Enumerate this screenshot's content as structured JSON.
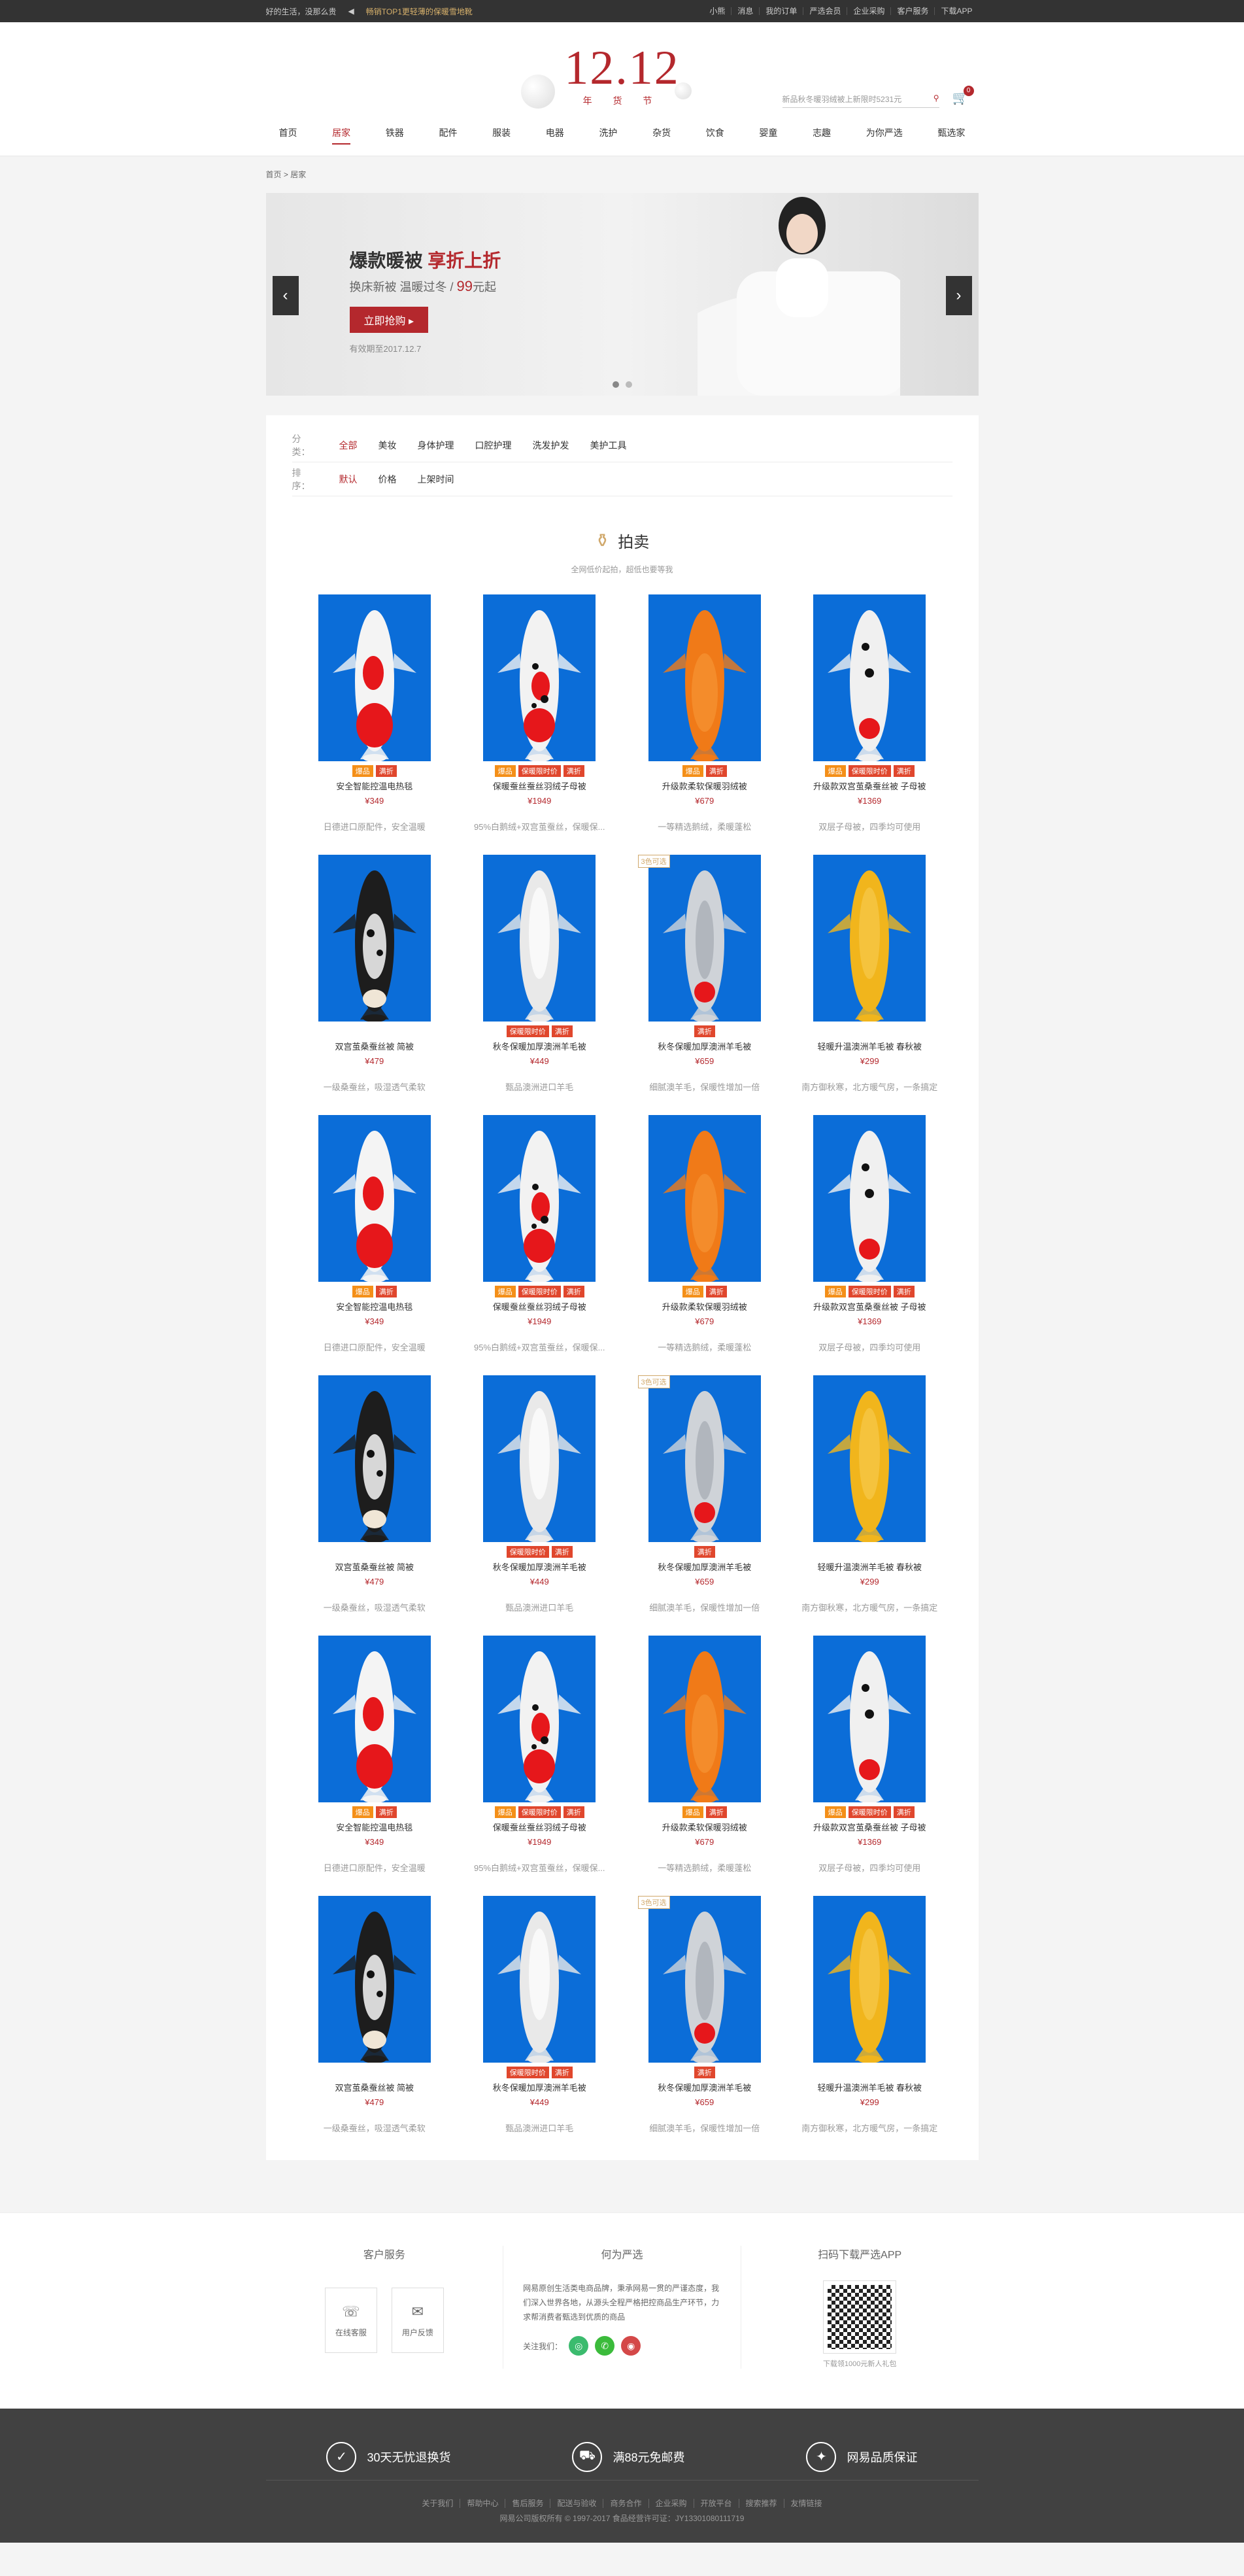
{
  "topbar": {
    "left_links": [
      "好的生活，没那么贵"
    ],
    "promo": "畅销TOP1更轻薄的保暖雪地靴",
    "right_links": [
      "小熊",
      "消息",
      "我的订单",
      "严选会员",
      "企业采购",
      "客户服务",
      "下载APP"
    ]
  },
  "header": {
    "logo_big": "12.12",
    "logo_sub": "年 货 节",
    "search_placeholder": "新品秋冬暖羽绒被上新限时5231元",
    "cart_count": "0",
    "nav": [
      "首页",
      "居家",
      "铁器",
      "配件",
      "服装",
      "电器",
      "洗护",
      "杂货",
      "饮食",
      "婴童",
      "志趣",
      "为你严选",
      "甄选家"
    ],
    "nav_active_index": 1
  },
  "breadcrumb": [
    "首页",
    "居家"
  ],
  "banner": {
    "title_a": "爆款暖被",
    "title_b": "享折上折",
    "sub_a": "换床新被 温暖过冬 / ",
    "price": "99",
    "sub_b": "元起",
    "button": "立即抢购",
    "date": "有效期至2017.12.7",
    "prev": "‹",
    "next": "›"
  },
  "filters": {
    "category_label": "分类：",
    "categories": [
      "全部",
      "美妆",
      "身体护理",
      "口腔护理",
      "洗发护发",
      "美护工具"
    ],
    "category_active": 0,
    "sort_label": "排序：",
    "sorts": [
      "默认",
      "价格",
      "上架时间"
    ],
    "sort_active": 0
  },
  "section": {
    "title": "拍卖",
    "desc": "全网低价起拍，超低也要等我"
  },
  "products": [
    {
      "name": "安全智能控温电热毯",
      "price": "¥349",
      "desc": "日德进口原配件，安全温暖",
      "tags": [
        [
          "爆品",
          "o"
        ],
        [
          "满折",
          "r"
        ]
      ],
      "corner": "",
      "fish": "kohaku"
    },
    {
      "name": "保暖蚕丝蚕丝羽绒子母被",
      "price": "¥1949",
      "desc": "95%白鹅绒+双宫茧蚕丝，保暖保...",
      "tags": [
        [
          "爆品",
          "o"
        ],
        [
          "保暖限时价",
          "r"
        ],
        [
          "满折",
          "r"
        ]
      ],
      "corner": "",
      "fish": "sanke"
    },
    {
      "name": "升级款柔软保暖羽绒被",
      "price": "¥679",
      "desc": "一等精选鹅绒，柔暖蓬松",
      "tags": [
        [
          "爆品",
          "o"
        ],
        [
          "满折",
          "r"
        ]
      ],
      "corner": "",
      "fish": "orange"
    },
    {
      "name": "升级款双宫茧桑蚕丝被 子母被",
      "price": "¥1369",
      "desc": "双层子母被，四季均可使用",
      "tags": [
        [
          "爆品",
          "o"
        ],
        [
          "保暖限时价",
          "r"
        ],
        [
          "满折",
          "r"
        ]
      ],
      "corner": "",
      "fish": "tancho"
    },
    {
      "name": "双宫茧桑蚕丝被 简被",
      "price": "¥479",
      "desc": "一级桑蚕丝，吸湿透气柔软",
      "tags": [],
      "corner": "",
      "fish": "showa"
    },
    {
      "name": "秋冬保暖加厚澳洲羊毛被",
      "price": "¥449",
      "desc": "甄品澳洲进口羊毛",
      "tags": [
        [
          "保暖限时价",
          "r"
        ],
        [
          "满折",
          "r"
        ]
      ],
      "corner": "",
      "fish": "white"
    },
    {
      "name": "秋冬保暖加厚澳洲羊毛被",
      "price": "¥659",
      "desc": "细腻澳羊毛，保暖性增加一倍",
      "tags": [
        [
          "满折",
          "r"
        ]
      ],
      "corner": "3色可选",
      "fish": "ginrin"
    },
    {
      "name": "轻暖升温澳洲羊毛被 春秋被",
      "price": "¥299",
      "desc": "南方御秋寒，北方暖气房，一条搞定",
      "tags": [],
      "corner": "",
      "fish": "yellow"
    },
    {
      "name": "安全智能控温电热毯",
      "price": "¥349",
      "desc": "日德进口原配件，安全温暖",
      "tags": [
        [
          "爆品",
          "o"
        ],
        [
          "满折",
          "r"
        ]
      ],
      "corner": "",
      "fish": "kohaku"
    },
    {
      "name": "保暖蚕丝蚕丝羽绒子母被",
      "price": "¥1949",
      "desc": "95%白鹅绒+双宫茧蚕丝，保暖保...",
      "tags": [
        [
          "爆品",
          "o"
        ],
        [
          "保暖限时价",
          "r"
        ],
        [
          "满折",
          "r"
        ]
      ],
      "corner": "",
      "fish": "sanke"
    },
    {
      "name": "升级款柔软保暖羽绒被",
      "price": "¥679",
      "desc": "一等精选鹅绒，柔暖蓬松",
      "tags": [
        [
          "爆品",
          "o"
        ],
        [
          "满折",
          "r"
        ]
      ],
      "corner": "",
      "fish": "orange"
    },
    {
      "name": "升级款双宫茧桑蚕丝被 子母被",
      "price": "¥1369",
      "desc": "双层子母被，四季均可使用",
      "tags": [
        [
          "爆品",
          "o"
        ],
        [
          "保暖限时价",
          "r"
        ],
        [
          "满折",
          "r"
        ]
      ],
      "corner": "",
      "fish": "tancho"
    },
    {
      "name": "双宫茧桑蚕丝被 简被",
      "price": "¥479",
      "desc": "一级桑蚕丝，吸湿透气柔软",
      "tags": [],
      "corner": "",
      "fish": "showa"
    },
    {
      "name": "秋冬保暖加厚澳洲羊毛被",
      "price": "¥449",
      "desc": "甄品澳洲进口羊毛",
      "tags": [
        [
          "保暖限时价",
          "r"
        ],
        [
          "满折",
          "r"
        ]
      ],
      "corner": "",
      "fish": "white"
    },
    {
      "name": "秋冬保暖加厚澳洲羊毛被",
      "price": "¥659",
      "desc": "细腻澳羊毛，保暖性增加一倍",
      "tags": [
        [
          "满折",
          "r"
        ]
      ],
      "corner": "3色可选",
      "fish": "ginrin"
    },
    {
      "name": "轻暖升温澳洲羊毛被 春秋被",
      "price": "¥299",
      "desc": "南方御秋寒，北方暖气房，一条搞定",
      "tags": [],
      "corner": "",
      "fish": "yellow"
    },
    {
      "name": "安全智能控温电热毯",
      "price": "¥349",
      "desc": "日德进口原配件，安全温暖",
      "tags": [
        [
          "爆品",
          "o"
        ],
        [
          "满折",
          "r"
        ]
      ],
      "corner": "",
      "fish": "kohaku"
    },
    {
      "name": "保暖蚕丝蚕丝羽绒子母被",
      "price": "¥1949",
      "desc": "95%白鹅绒+双宫茧蚕丝，保暖保...",
      "tags": [
        [
          "爆品",
          "o"
        ],
        [
          "保暖限时价",
          "r"
        ],
        [
          "满折",
          "r"
        ]
      ],
      "corner": "",
      "fish": "sanke"
    },
    {
      "name": "升级款柔软保暖羽绒被",
      "price": "¥679",
      "desc": "一等精选鹅绒，柔暖蓬松",
      "tags": [
        [
          "爆品",
          "o"
        ],
        [
          "满折",
          "r"
        ]
      ],
      "corner": "",
      "fish": "orange"
    },
    {
      "name": "升级款双宫茧桑蚕丝被 子母被",
      "price": "¥1369",
      "desc": "双层子母被，四季均可使用",
      "tags": [
        [
          "爆品",
          "o"
        ],
        [
          "保暖限时价",
          "r"
        ],
        [
          "满折",
          "r"
        ]
      ],
      "corner": "",
      "fish": "tancho"
    },
    {
      "name": "双宫茧桑蚕丝被 简被",
      "price": "¥479",
      "desc": "一级桑蚕丝，吸湿透气柔软",
      "tags": [],
      "corner": "",
      "fish": "showa"
    },
    {
      "name": "秋冬保暖加厚澳洲羊毛被",
      "price": "¥449",
      "desc": "甄品澳洲进口羊毛",
      "tags": [
        [
          "保暖限时价",
          "r"
        ],
        [
          "满折",
          "r"
        ]
      ],
      "corner": "",
      "fish": "white"
    },
    {
      "name": "秋冬保暖加厚澳洲羊毛被",
      "price": "¥659",
      "desc": "细腻澳羊毛，保暖性增加一倍",
      "tags": [
        [
          "满折",
          "r"
        ]
      ],
      "corner": "3色可选",
      "fish": "ginrin"
    },
    {
      "name": "轻暖升温澳洲羊毛被 春秋被",
      "price": "¥299",
      "desc": "南方御秋寒，北方暖气房，一条搞定",
      "tags": [],
      "corner": "",
      "fish": "yellow"
    }
  ],
  "services": {
    "col1_title": "客户服务",
    "boxes": [
      "在线客服",
      "用户反馈"
    ],
    "col2_title": "何为严选",
    "about": "网易原创生活类电商品牌，秉承网易一贯的严谨态度，我们深入世界各地，从源头全程严格把控商品生产环节，力求帮消费者甄选到优质的商品",
    "follow_label": "关注我们：",
    "col3_title": "扫码下载严选APP",
    "qr_text": "下载领1000元新人礼包"
  },
  "dark_footer": {
    "promises": [
      "30天无忧退换货",
      "满88元免邮费",
      "网易品质保证"
    ],
    "promise_icons": [
      "✓",
      "⛟",
      "✦"
    ],
    "links": [
      "关于我们",
      "帮助中心",
      "售后服务",
      "配送与验收",
      "商务合作",
      "企业采购",
      "开放平台",
      "搜索推荐",
      "友情链接"
    ],
    "copyright": "网易公司版权所有 © 1997-2017   食品经营许可证：JY13301080111719"
  },
  "colors": {
    "brand": "#b4282d",
    "tag_orange": "#f48f18",
    "tag_red": "#e0472d",
    "fish_bg": "#0b6dd8"
  }
}
